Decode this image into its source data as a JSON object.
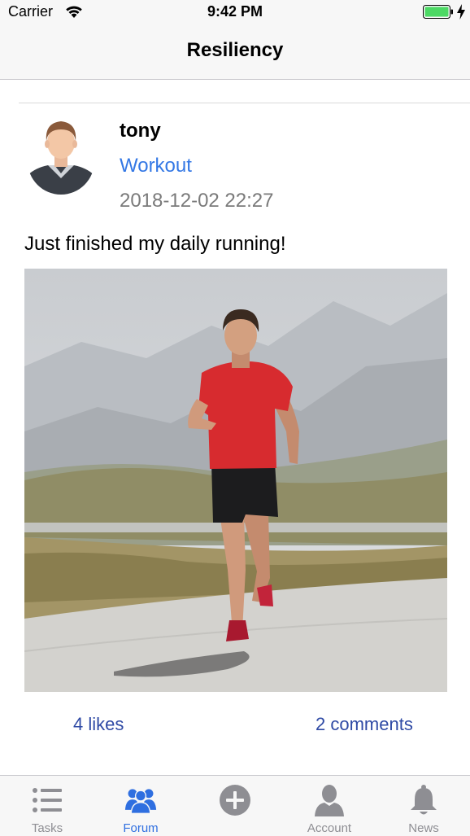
{
  "status_bar": {
    "carrier": "Carrier",
    "time": "9:42 PM",
    "battery_color": "#4cd964"
  },
  "nav": {
    "title": "Resiliency"
  },
  "post": {
    "author": "tony",
    "category": "Workout",
    "timestamp": "2018-12-02 22:27",
    "text": "Just finished my daily running!",
    "likes_label": "4 likes",
    "comments_label": "2 comments",
    "link_color": "#2f4aa5",
    "category_color": "#3478e5"
  },
  "tab_bar": {
    "active_color": "#2f6fe0",
    "inactive_color": "#8e8e93",
    "tabs": [
      {
        "label": "Tasks",
        "icon": "list-icon"
      },
      {
        "label": "Forum",
        "icon": "people-icon",
        "active": true
      },
      {
        "label": "",
        "icon": "add-circle-icon"
      },
      {
        "label": "Account",
        "icon": "person-icon"
      },
      {
        "label": "News",
        "icon": "bell-icon"
      }
    ]
  }
}
